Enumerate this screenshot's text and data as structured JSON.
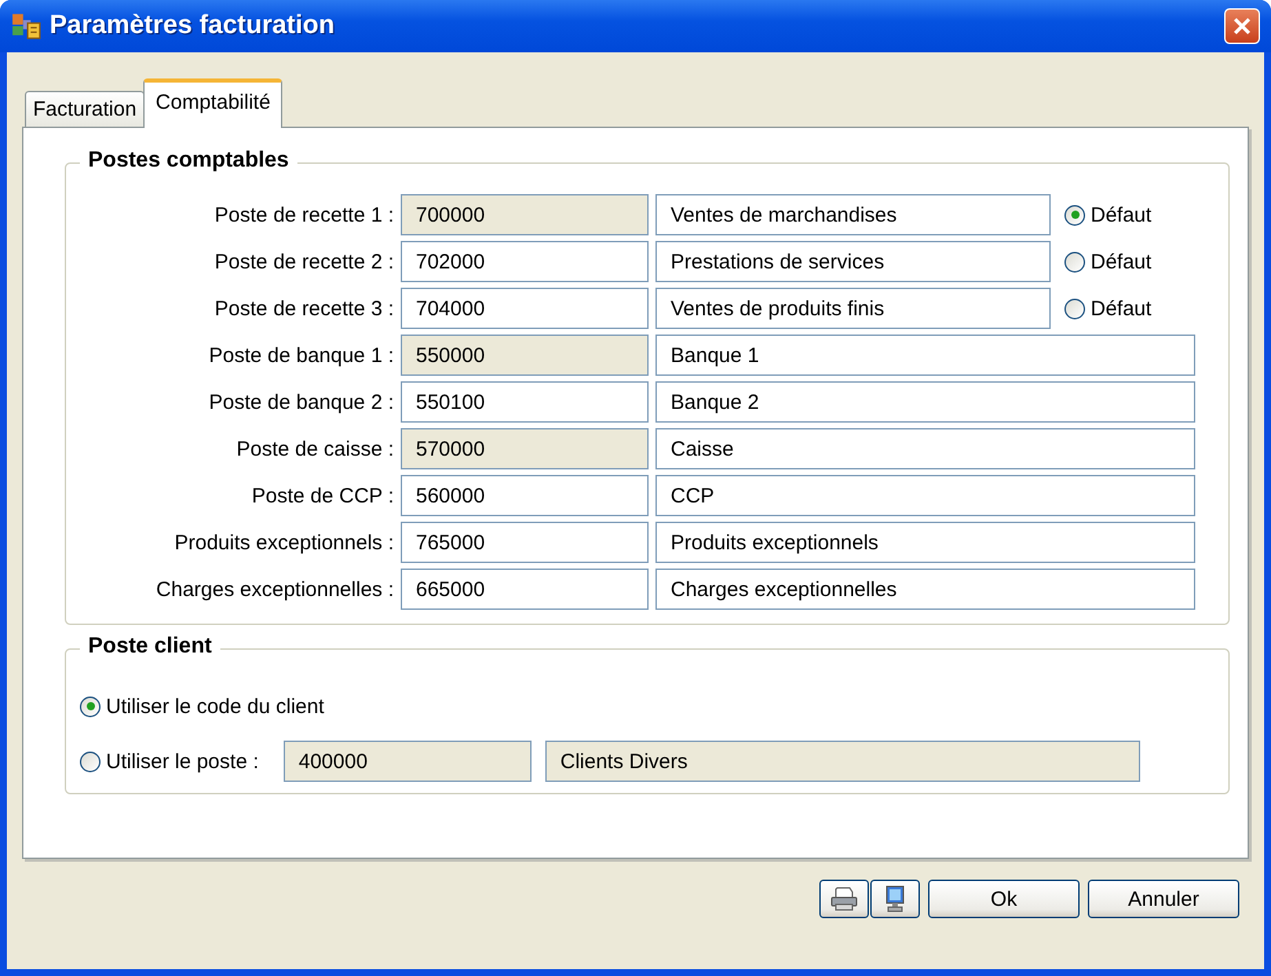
{
  "window": {
    "title": "Paramètres facturation"
  },
  "tabs": [
    {
      "label": "Facturation",
      "selected": false
    },
    {
      "label": "Comptabilité",
      "selected": true
    }
  ],
  "accounts_group": {
    "title": "Postes comptables",
    "rows": [
      {
        "kind": "default",
        "label": "Poste de recette 1 :",
        "code": "700000",
        "code_disabled": true,
        "name": "Ventes de marchandises",
        "option_label": "Défaut",
        "selected": true
      },
      {
        "kind": "default",
        "label": "Poste de recette 2 :",
        "code": "702000",
        "code_disabled": false,
        "name": "Prestations de services",
        "option_label": "Défaut",
        "selected": false
      },
      {
        "kind": "default",
        "label": "Poste de recette 3 :",
        "code": "704000",
        "code_disabled": false,
        "name": "Ventes de produits finis",
        "option_label": "Défaut",
        "selected": false
      },
      {
        "kind": "plain",
        "label": "Poste de banque 1 :",
        "code": "550000",
        "code_disabled": true,
        "name": "Banque 1"
      },
      {
        "kind": "plain",
        "label": "Poste de banque 2 :",
        "code": "550100",
        "code_disabled": false,
        "name": "Banque 2"
      },
      {
        "kind": "plain",
        "label": "Poste de caisse :",
        "code": "570000",
        "code_disabled": true,
        "name": "Caisse"
      },
      {
        "kind": "plain",
        "label": "Poste de CCP :",
        "code": "560000",
        "code_disabled": false,
        "name": "CCP"
      },
      {
        "kind": "plain",
        "label": "Produits exceptionnels :",
        "code": "765000",
        "code_disabled": false,
        "name": "Produits exceptionnels"
      },
      {
        "kind": "plain",
        "label": "Charges exceptionnelles :",
        "code": "665000",
        "code_disabled": false,
        "name": "Charges exceptionnelles"
      }
    ]
  },
  "client_group": {
    "title": "Poste client",
    "options": [
      {
        "label": "Utiliser le code du client",
        "selected": true
      },
      {
        "label": "Utiliser le poste :",
        "selected": false,
        "code": "400000",
        "name": "Clients Divers",
        "disabled": true
      }
    ]
  },
  "buttons": [
    {
      "kind": "printer"
    },
    {
      "kind": "monitor"
    },
    {
      "kind": "text",
      "label": "Ok"
    },
    {
      "kind": "text",
      "label": "Annuler"
    }
  ]
}
